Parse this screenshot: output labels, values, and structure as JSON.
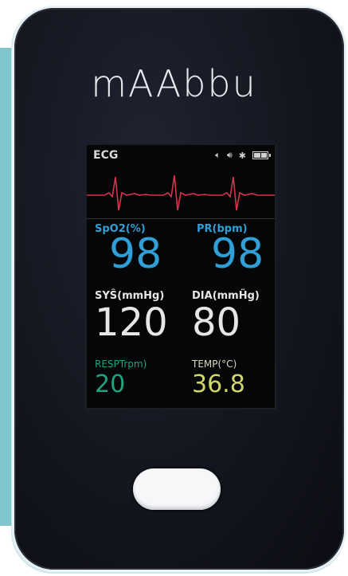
{
  "device": {
    "brand": "mAAbbu",
    "colors": {
      "body": "#14161f",
      "screen": "#050607",
      "button": "#f6f7f9"
    }
  },
  "screen": {
    "ecg_label": "ECG",
    "status_icons": [
      "speaker-muted-icon",
      "speaker-icon",
      "bluetooth-icon",
      "battery-icon"
    ],
    "vitals": {
      "spo2": {
        "label": "SpO2(%)",
        "value": "98",
        "color": "#2f9fd6"
      },
      "pr": {
        "label": "PR(bpm)",
        "value": "98",
        "color": "#2f9fd6"
      },
      "sys": {
        "label": "SYŜ(mmHg)",
        "value": "120",
        "color": "#e6e6e6"
      },
      "dia": {
        "label": "DIA(mmḦg)",
        "value": "80",
        "color": "#e6e6e6"
      },
      "resp": {
        "label": "RESPTrpm)",
        "value": "20",
        "color": "#1fa37a"
      },
      "temp": {
        "label": "TEMP(°C)",
        "value": "36.8",
        "color": "#cfd66a"
      }
    },
    "ecg_color": "#d8324a"
  }
}
